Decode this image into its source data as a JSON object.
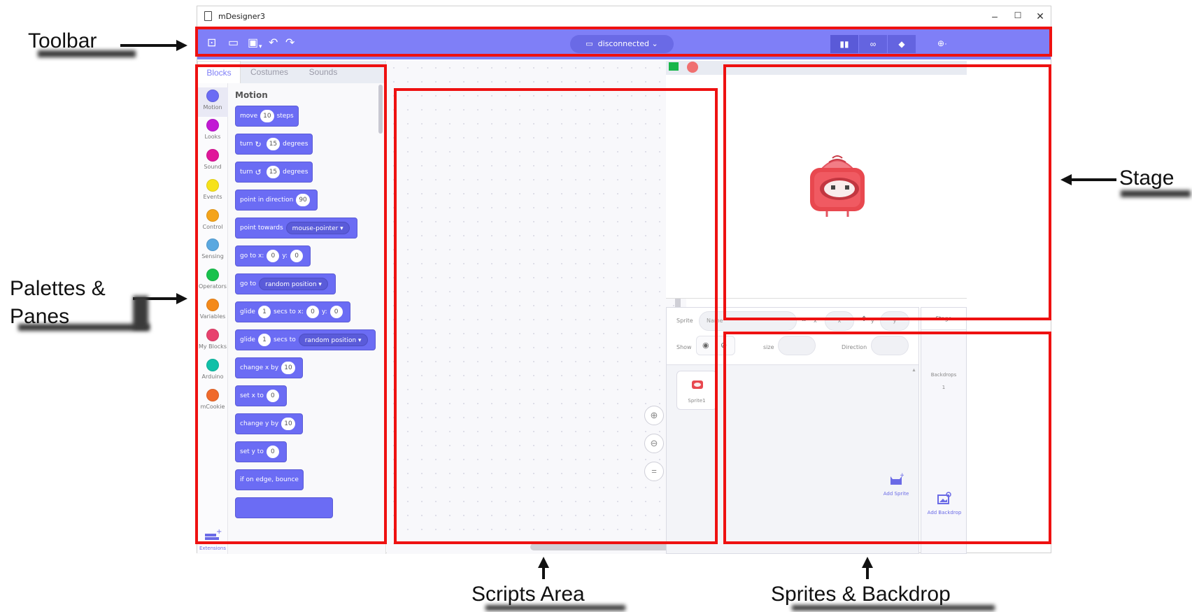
{
  "window": {
    "title": "mDesigner3"
  },
  "toolbar": {
    "connection": "disconnected"
  },
  "tabs": [
    "Blocks",
    "Costumes",
    "Sounds"
  ],
  "categories": [
    {
      "label": "Motion",
      "color": "#6b6cf4"
    },
    {
      "label": "Looks",
      "color": "#c21ad4"
    },
    {
      "label": "Sound",
      "color": "#e0179a"
    },
    {
      "label": "Events",
      "color": "#f6e21b"
    },
    {
      "label": "Control",
      "color": "#f4a41b"
    },
    {
      "label": "Sensing",
      "color": "#5aa8e0"
    },
    {
      "label": "Operators",
      "color": "#19c24d"
    },
    {
      "label": "Variables",
      "color": "#f48a1b"
    },
    {
      "label": "My Blocks",
      "color": "#e8426e"
    },
    {
      "label": "Arduino",
      "color": "#10c0a8"
    },
    {
      "label": "mCookie",
      "color": "#f06a2c"
    }
  ],
  "extensions_label": "Extensions",
  "palette": {
    "title": "Motion",
    "b1": {
      "a": "move",
      "v": "10",
      "b": "steps"
    },
    "b2": {
      "a": "turn",
      "v": "15",
      "b": "degrees"
    },
    "b3": {
      "a": "turn",
      "v": "15",
      "b": "degrees"
    },
    "b4": {
      "a": "point in direction",
      "v": "90"
    },
    "b5": {
      "a": "point towards",
      "d": "mouse-pointer ▾"
    },
    "b6": {
      "a": "go to x:",
      "v": "0",
      "b": "y:",
      "v2": "0"
    },
    "b7": {
      "a": "go to",
      "d": "random position ▾"
    },
    "b8": {
      "a": "glide",
      "v": "1",
      "b": "secs to x:",
      "v2": "0",
      "c": "y:",
      "v3": "0"
    },
    "b9": {
      "a": "glide",
      "v": "1",
      "b": "secs to",
      "d": "random position ▾"
    },
    "b10": {
      "a": "change x by",
      "v": "10"
    },
    "b11": {
      "a": "set x to",
      "v": "0"
    },
    "b12": {
      "a": "change y by",
      "v": "10"
    },
    "b13": {
      "a": "set y to",
      "v": "0"
    },
    "b14": {
      "a": "if on edge, bounce"
    }
  },
  "sprite_info": {
    "sprite_label": "Sprite",
    "name_placeholder": "Name",
    "x_label": "x",
    "x_placeholder": "x",
    "y_label": "y",
    "y_placeholder": "y",
    "show_label": "Show",
    "size_label": "size",
    "direction_label": "Direction"
  },
  "sprites": [
    {
      "name": "Sprite1"
    }
  ],
  "add_sprite": "Add Sprite",
  "stage_panel": {
    "title": "Stage",
    "backdrops_label": "Backdrops",
    "backdrops_count": "1",
    "add_backdrop": "Add Backdrop"
  },
  "annotations": {
    "toolbar": "Toolbar",
    "palettes_1": "Palettes &",
    "palettes_2": "Panes",
    "stage": "Stage",
    "scripts": "Scripts Area",
    "sprites": "Sprites & Backdrop"
  },
  "colors": {
    "accent": "#7f7ff7",
    "block": "#6b6cf4",
    "highlight": "#ee1111"
  }
}
